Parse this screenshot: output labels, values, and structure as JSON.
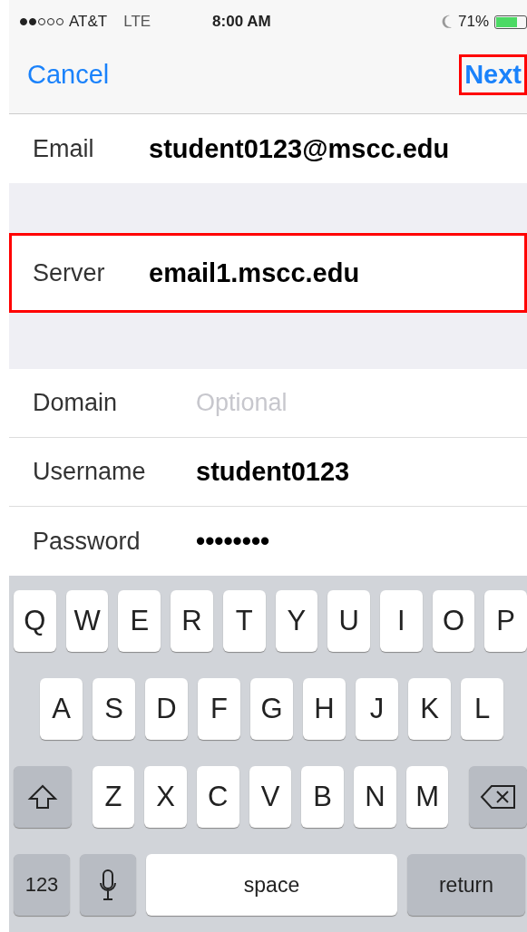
{
  "status_bar": {
    "carrier": "AT&T",
    "network": "LTE",
    "time": "8:00 AM",
    "battery_text": "71%"
  },
  "nav": {
    "cancel": "Cancel",
    "next": {
      "label": "Next",
      "highlighted": true
    }
  },
  "sections": [
    {
      "rows": [
        {
          "label": "Email",
          "value": "student0123@mscc.edu",
          "highlighted": false
        }
      ]
    },
    {
      "rows": [
        {
          "label": "Server",
          "value": "email1.mscc.edu",
          "highlighted": true
        }
      ]
    },
    {
      "rows": [
        {
          "label": "Domain",
          "placeholder": "Optional",
          "highlighted": false
        },
        {
          "label": "Username",
          "value": "student0123",
          "highlighted": false
        },
        {
          "label": "Password",
          "value": "••••••••",
          "highlighted": false
        }
      ]
    }
  ],
  "keyboard": {
    "rows": [
      {
        "keys": [
          {
            "kind": "letter",
            "label": "Q"
          },
          {
            "kind": "letter",
            "label": "W"
          },
          {
            "kind": "letter",
            "label": "E"
          },
          {
            "kind": "letter",
            "label": "R"
          },
          {
            "kind": "letter",
            "label": "T"
          },
          {
            "kind": "letter",
            "label": "Y"
          },
          {
            "kind": "letter",
            "label": "U"
          },
          {
            "kind": "letter",
            "label": "I"
          },
          {
            "kind": "letter",
            "label": "O"
          },
          {
            "kind": "letter",
            "label": "P"
          }
        ]
      },
      {
        "keys": [
          {
            "kind": "letter",
            "label": "A"
          },
          {
            "kind": "letter",
            "label": "S"
          },
          {
            "kind": "letter",
            "label": "D"
          },
          {
            "kind": "letter",
            "label": "F"
          },
          {
            "kind": "letter",
            "label": "G"
          },
          {
            "kind": "letter",
            "label": "H"
          },
          {
            "kind": "letter",
            "label": "J"
          },
          {
            "kind": "letter",
            "label": "K"
          },
          {
            "kind": "letter",
            "label": "L"
          }
        ]
      },
      {
        "keys": [
          {
            "kind": "shift"
          },
          {
            "kind": "letter",
            "label": "Z"
          },
          {
            "kind": "letter",
            "label": "X"
          },
          {
            "kind": "letter",
            "label": "C"
          },
          {
            "kind": "letter",
            "label": "V"
          },
          {
            "kind": "letter",
            "label": "B"
          },
          {
            "kind": "letter",
            "label": "N"
          },
          {
            "kind": "letter",
            "label": "M"
          },
          {
            "kind": "delete"
          }
        ]
      },
      {
        "keys": [
          {
            "kind": "numbers",
            "label": "123"
          },
          {
            "kind": "mic"
          },
          {
            "kind": "space",
            "label": "space"
          },
          {
            "kind": "return",
            "label": "return"
          }
        ]
      }
    ]
  }
}
